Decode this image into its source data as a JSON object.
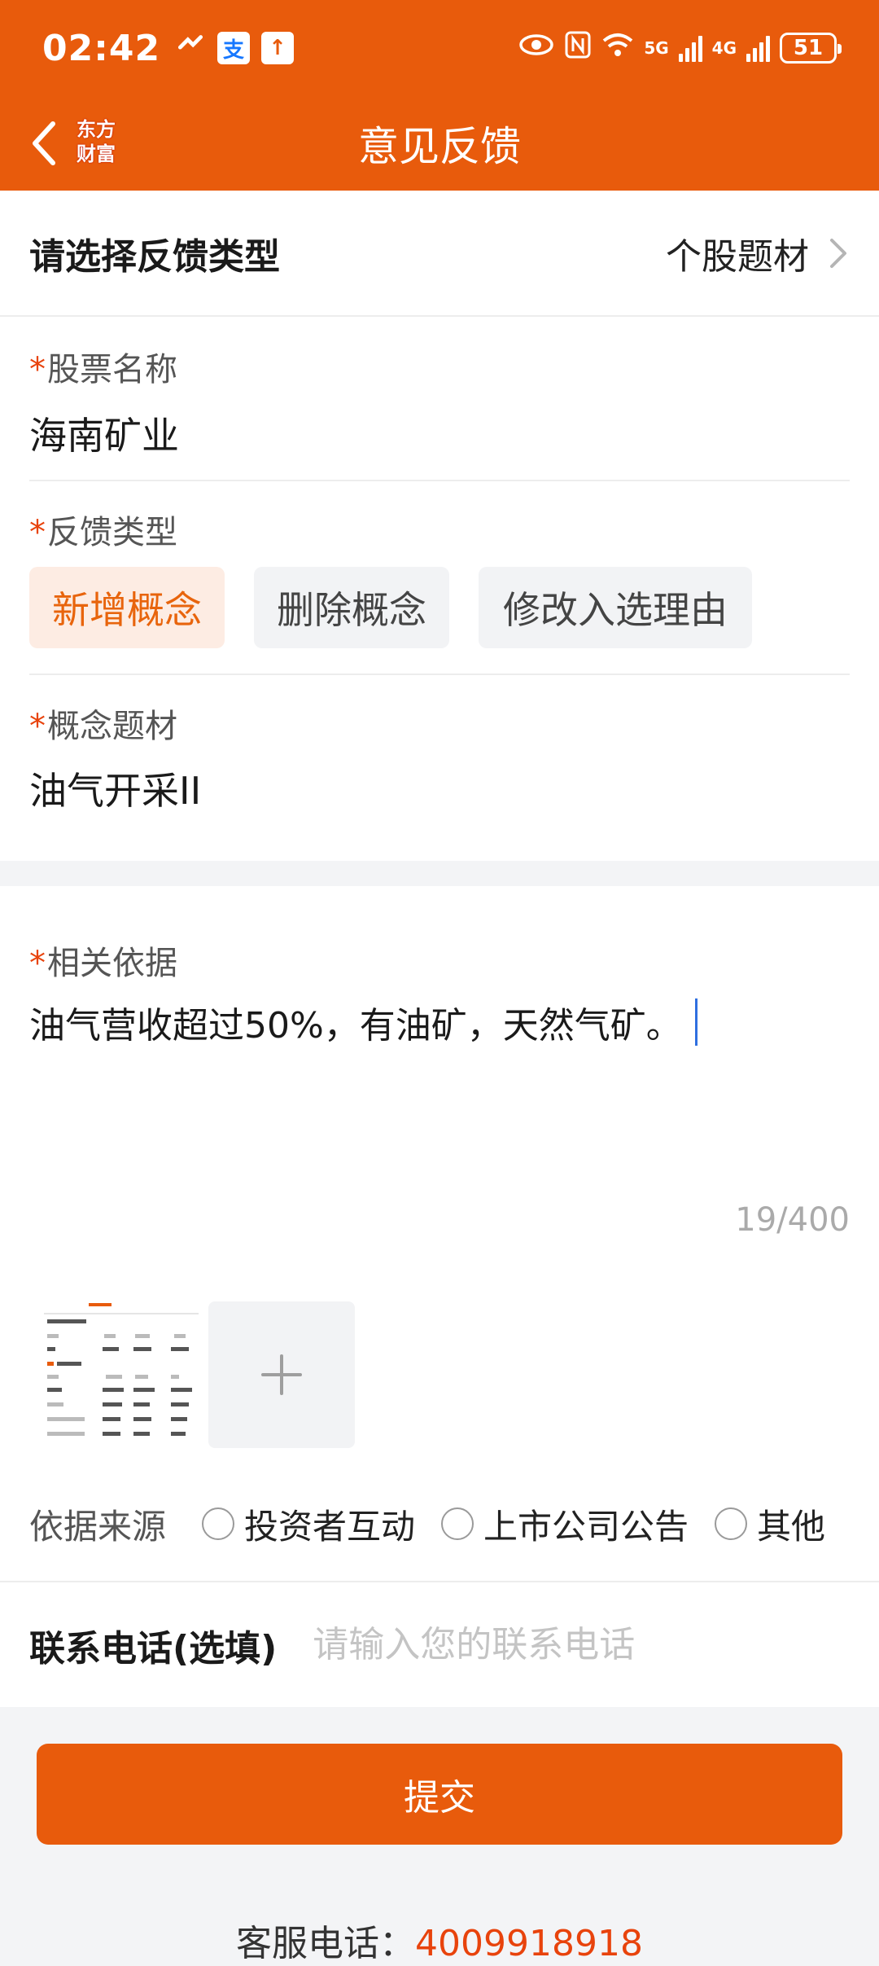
{
  "status_bar": {
    "time": "02:42",
    "network_5g": "5G",
    "network_4g": "4G",
    "battery": "51"
  },
  "nav": {
    "title": "意见反馈",
    "logo_line1": "东方",
    "logo_line2": "财富"
  },
  "feedback_type": {
    "label": "请选择反馈类型",
    "value": "个股题材"
  },
  "stock_name": {
    "label": "股票名称",
    "value": "海南矿业"
  },
  "feedback_kind": {
    "label": "反馈类型",
    "options": [
      "新增概念",
      "删除概念",
      "修改入选理由"
    ],
    "selected": "新增概念"
  },
  "concept": {
    "label": "概念题材",
    "value": "油气开采II"
  },
  "basis": {
    "label": "相关依据",
    "value": "油气营收超过50%，有油矿，天然气矿。",
    "counter": "19/400"
  },
  "source": {
    "label": "依据来源",
    "options": [
      "投资者互动",
      "上市公司公告",
      "其他"
    ]
  },
  "phone": {
    "label": "联系电话(选填)",
    "placeholder": "请输入您的联系电话"
  },
  "submit_label": "提交",
  "service": {
    "label": "客服电话：",
    "number": "4009918918"
  },
  "colors": {
    "brand": "#e85b0c",
    "required": "#e8430c",
    "chip_active_bg": "#fdece3",
    "chip_active_text": "#e8640c"
  }
}
